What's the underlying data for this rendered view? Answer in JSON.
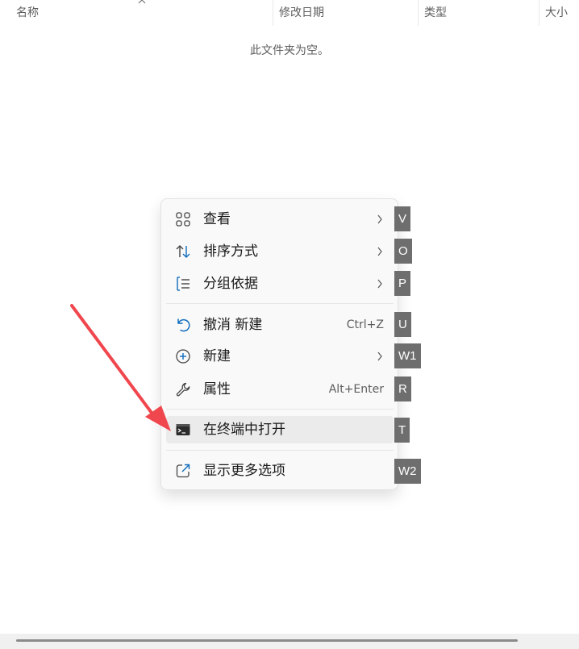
{
  "columns": {
    "name": "名称",
    "modified": "修改日期",
    "type": "类型",
    "size": "大小"
  },
  "empty_message": "此文件夹为空。",
  "context_menu": {
    "view": {
      "label": "查看",
      "icon": "grid-icon"
    },
    "sort": {
      "label": "排序方式",
      "icon": "sort-icon"
    },
    "group": {
      "label": "分组依据",
      "icon": "group-list-icon"
    },
    "undo": {
      "label": "撤消 新建",
      "shortcut": "Ctrl+Z",
      "icon": "undo-icon"
    },
    "new": {
      "label": "新建",
      "icon": "plus-circle-icon"
    },
    "properties": {
      "label": "属性",
      "shortcut": "Alt+Enter",
      "icon": "wrench-icon"
    },
    "open_terminal": {
      "label": "在终端中打开",
      "icon": "terminal-icon"
    },
    "more_options": {
      "label": "显示更多选项",
      "icon": "share-icon"
    }
  },
  "hotkeys": {
    "view": "V",
    "sort": "O",
    "group": "P",
    "undo": "U",
    "new": "W1",
    "properties": "R",
    "open_terminal": "T",
    "more_options": "W2"
  },
  "colors": {
    "accent": "#0f6cbd",
    "badge": "#6e6e6e",
    "arrow": "#f0474e",
    "hover": "#ebebeb"
  }
}
